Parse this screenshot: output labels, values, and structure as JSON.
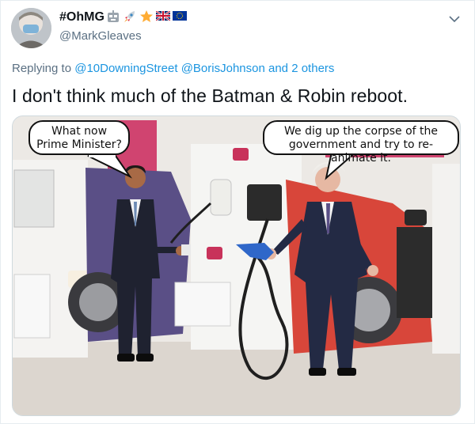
{
  "tweet": {
    "display_name": "#OhMG",
    "handle": "@MarkGleaves",
    "emoji_names": [
      "robot-face-icon",
      "rocket-icon",
      "star-icon",
      "uk-flag-icon",
      "eu-flag-icon"
    ],
    "replying_prefix": "Replying to",
    "replying_mentions": [
      "@10DowningStreet",
      "@BorisJohnson"
    ],
    "replying_and": "and",
    "replying_others": "2 others",
    "text": "I don't think much of the Batman & Robin reboot.",
    "colors": {
      "link": "#1b95e0",
      "secondary": "#5b7083",
      "primary": "#0f1419"
    }
  },
  "media": {
    "bubble_left": "What now Prime Minister?",
    "bubble_right": "We dig up the corpse of the government and try to re-animate it."
  }
}
